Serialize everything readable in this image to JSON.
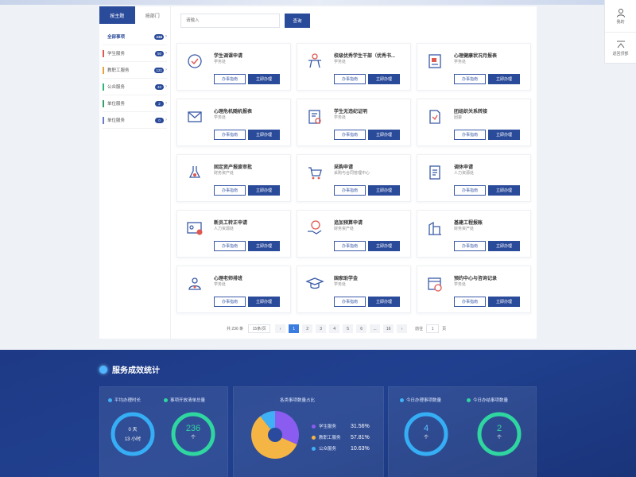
{
  "sidebar_fixed": {
    "user_label": "我的",
    "top_label": "返回顶部"
  },
  "category": {
    "tabs": [
      "按主题",
      "按部门"
    ],
    "items": [
      {
        "label": "全部事项",
        "count": "236",
        "color": "#2a4a9a",
        "active": true
      },
      {
        "label": "学生服务",
        "count": "50",
        "color": "#e05a4e"
      },
      {
        "label": "教职工服务",
        "count": "121",
        "color": "#e8a23c"
      },
      {
        "label": "公众服务",
        "count": "40",
        "color": "#2fb37a"
      },
      {
        "label": "单位服务",
        "count": "2",
        "color": "#33a06a"
      },
      {
        "label": "单位服务",
        "count": "0",
        "color": "#6b7bd1"
      }
    ]
  },
  "search": {
    "placeholder": "请输入",
    "button": "查询"
  },
  "card_buttons": {
    "guide": "办事指南",
    "do": "立即办理"
  },
  "cards": [
    {
      "title": "学生调课申请",
      "dept": "学务处",
      "icon": "clock-check-icon"
    },
    {
      "title": "校级优秀学生干部（优秀书...",
      "dept": "学务处",
      "icon": "award-person-icon"
    },
    {
      "title": "心理健康状况月报表",
      "dept": "学务处",
      "icon": "report-book-icon"
    },
    {
      "title": "心理危机随机报表",
      "dept": "学务处",
      "icon": "envelope-icon"
    },
    {
      "title": "学生无违纪证明",
      "dept": "学务处",
      "icon": "certificate-icon"
    },
    {
      "title": "团组织关系转接",
      "dept": "团委",
      "icon": "transfer-doc-icon"
    },
    {
      "title": "固定资产报废审批",
      "dept": "财务资产处",
      "icon": "flask-icon"
    },
    {
      "title": "采购申请",
      "dept": "采购与合同管理中心",
      "icon": "cart-icon"
    },
    {
      "title": "调休申请",
      "dept": "人力资源处",
      "icon": "document-icon"
    },
    {
      "title": "新员工转正申请",
      "dept": "人力资源处",
      "icon": "id-card-icon"
    },
    {
      "title": "追加预算申请",
      "dept": "财务资产处",
      "icon": "hand-money-icon"
    },
    {
      "title": "基建工程报账",
      "dept": "财务资产处",
      "icon": "building-icon"
    },
    {
      "title": "心理老师排班",
      "dept": "学务处",
      "icon": "counselor-icon"
    },
    {
      "title": "国家助学金",
      "dept": "学务处",
      "icon": "grad-cap-icon"
    },
    {
      "title": "预约中心与咨询记录",
      "dept": "学务处",
      "icon": "calendar-clock-icon"
    }
  ],
  "pager": {
    "total": "共 236 条",
    "size": "15条/页",
    "prev": "‹",
    "pages": [
      "1",
      "2",
      "3",
      "4",
      "5",
      "6",
      "...",
      "16"
    ],
    "next": "›",
    "goto_label": "前往",
    "goto_value": "1",
    "page_unit": "页"
  },
  "stats": {
    "title": "服务成效统计",
    "box1": {
      "label1": "平均办理时长",
      "label2": "事项开放清单总量",
      "ring1_line1": "0 天",
      "ring1_line2": "13 小时",
      "ring2_value": "236",
      "ring2_unit": "个"
    },
    "box2": {
      "label": "各类事项数量占比",
      "legend": [
        {
          "name": "学生服务",
          "pct": "31.56%",
          "color": "#8a5cf0",
          "value": 31.56
        },
        {
          "name": "教职工服务",
          "pct": "57.81%",
          "color": "#f5b544",
          "value": 57.81
        },
        {
          "name": "公众服务",
          "pct": "10.63%",
          "color": "#3fb0f5",
          "value": 10.63
        }
      ]
    },
    "box3": {
      "label1": "今日办理事项数量",
      "label2": "今日办结事项数量",
      "ring1_value": "4",
      "ring1_unit": "个",
      "ring2_value": "2",
      "ring2_unit": "个"
    }
  }
}
